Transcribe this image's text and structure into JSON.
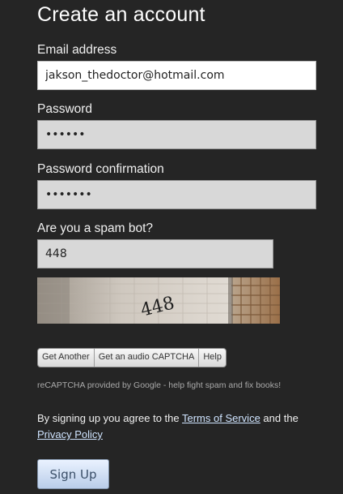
{
  "form": {
    "title": "Create an account",
    "email": {
      "label": "Email address",
      "value": "jakson_thedoctor@hotmail.com"
    },
    "password": {
      "label": "Password",
      "value": "••••••"
    },
    "password_confirmation": {
      "label": "Password confirmation",
      "value": "•••••••"
    },
    "spam_check": {
      "label": "Are you a spam bot?",
      "value": "448"
    },
    "captcha": {
      "image_text": "448",
      "buttons": [
        "Get Another",
        "Get an audio CAPTCHA",
        "Help"
      ],
      "note": "reCAPTCHA provided by Google - help fight spam and fix books!"
    },
    "terms": {
      "prefix": "By signing up you agree to the ",
      "tos_link": "Terms of Service",
      "middle": " and the",
      "privacy_link": "Privacy Policy"
    },
    "submit_label": "Sign Up"
  },
  "colors": {
    "background": "#252525",
    "link": "#cfe4ff",
    "button_gradient_top": "#eaf2ff",
    "button_gradient_bottom": "#b9cde9"
  }
}
